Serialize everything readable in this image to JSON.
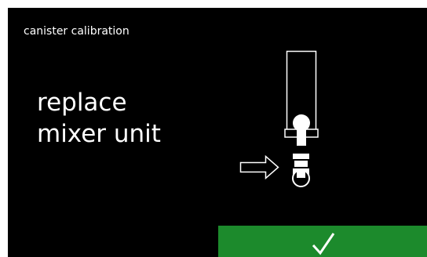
{
  "header": {
    "title": "canister calibration"
  },
  "instruction": {
    "line1": "replace",
    "line2": "mixer unit"
  },
  "illustration": {
    "canister_icon": "canister-outline-icon",
    "arrow_icon": "right-arrow-icon",
    "mixer_icon": "mixer-unit-icon"
  },
  "actions": {
    "confirm_icon": "check-icon"
  },
  "colors": {
    "background": "#000000",
    "foreground": "#ffffff",
    "confirm": "#1c8a2c"
  }
}
